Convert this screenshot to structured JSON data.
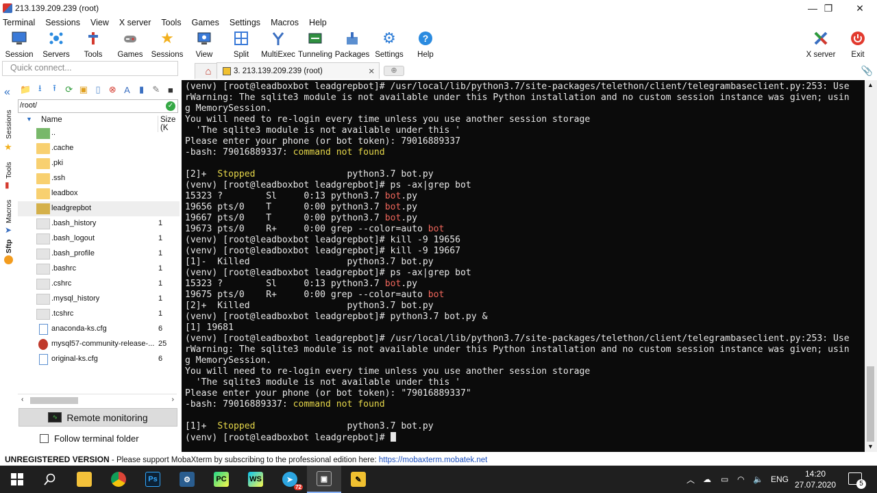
{
  "window": {
    "title": "213.139.209.239 (root)",
    "minimize": "—",
    "restore": "❐",
    "close": "✕"
  },
  "menu": [
    "Terminal",
    "Sessions",
    "View",
    "X server",
    "Tools",
    "Games",
    "Settings",
    "Macros",
    "Help"
  ],
  "toolbar": {
    "session": "Session",
    "servers": "Servers",
    "tools": "Tools",
    "games": "Games",
    "sessions": "Sessions",
    "view": "View",
    "split": "Split",
    "multiexec": "MultiExec",
    "tunneling": "Tunneling",
    "packages": "Packages",
    "settings": "Settings",
    "help": "Help",
    "xserver": "X server",
    "exit": "Exit"
  },
  "quick_connect": {
    "placeholder": "Quick connect..."
  },
  "tabs": {
    "active_tab": "3. 213.139.209.239 (root)",
    "close": "✕",
    "new_tab": "⊕"
  },
  "side_tabs": {
    "sessions": "Sessions",
    "tools": "Tools",
    "macros": "Macros",
    "sftp": "Sftp"
  },
  "sftp": {
    "path": "/root/",
    "col_name": "Name",
    "col_size": "Size (K",
    "files": [
      {
        "name": "..",
        "size": "",
        "kind": "up"
      },
      {
        "name": ".cache",
        "size": "",
        "kind": "folder"
      },
      {
        "name": ".pki",
        "size": "",
        "kind": "folder"
      },
      {
        "name": ".ssh",
        "size": "",
        "kind": "folder"
      },
      {
        "name": "leadbox",
        "size": "",
        "kind": "folder"
      },
      {
        "name": "leadgrepbot",
        "size": "",
        "kind": "folderd"
      },
      {
        "name": ".bash_history",
        "size": "1",
        "kind": "file"
      },
      {
        "name": ".bash_logout",
        "size": "1",
        "kind": "file"
      },
      {
        "name": ".bash_profile",
        "size": "1",
        "kind": "file"
      },
      {
        "name": ".bashrc",
        "size": "1",
        "kind": "file"
      },
      {
        "name": ".cshrc",
        "size": "1",
        "kind": "file"
      },
      {
        "name": ".mysql_history",
        "size": "1",
        "kind": "file"
      },
      {
        "name": ".tcshrc",
        "size": "1",
        "kind": "file"
      },
      {
        "name": "anaconda-ks.cfg",
        "size": "6",
        "kind": "doc"
      },
      {
        "name": "mysql57-community-release-...",
        "size": "25",
        "kind": "rpm"
      },
      {
        "name": "original-ks.cfg",
        "size": "6",
        "kind": "doc"
      }
    ],
    "remote_monitoring": "Remote monitoring",
    "follow_terminal": "Follow terminal folder"
  },
  "terminal": {
    "lines": [
      [
        {
          "t": "(venv) [root@leadboxbot leadgrepbot]# /usr/local/lib/python3.7/site-packages/telethon/client/telegrambaseclient.py:253: Use"
        }
      ],
      [
        {
          "t": "rWarning: The sqlite3 module is not available under this Python installation and no custom session instance was given; usin"
        }
      ],
      [
        {
          "t": "g MemorySession."
        }
      ],
      [
        {
          "t": "You will need to re-login every time unless you use another session storage"
        }
      ],
      [
        {
          "t": "  'The sqlite3 module is not available under this '"
        }
      ],
      [
        {
          "t": "Please enter your phone (or bot token): 79016889337"
        }
      ],
      [
        {
          "t": "-bash: 79016889337: "
        },
        {
          "t": "command not found",
          "c": "y"
        }
      ],
      [
        {
          "t": ""
        }
      ],
      [
        {
          "t": "[2]+  "
        },
        {
          "t": "Stopped",
          "c": "y"
        },
        {
          "t": "                 python3.7 bot.py"
        }
      ],
      [
        {
          "t": "(venv) [root@leadboxbot leadgrepbot]# ps -ax|grep bot"
        }
      ],
      [
        {
          "t": "15323 ?        Sl     0:13 python3.7 "
        },
        {
          "t": "bot",
          "c": "r"
        },
        {
          "t": ".py"
        }
      ],
      [
        {
          "t": "19656 pts/0    T      0:00 python3.7 "
        },
        {
          "t": "bot",
          "c": "r"
        },
        {
          "t": ".py"
        }
      ],
      [
        {
          "t": "19667 pts/0    T      0:00 python3.7 "
        },
        {
          "t": "bot",
          "c": "r"
        },
        {
          "t": ".py"
        }
      ],
      [
        {
          "t": "19673 pts/0    R+     0:00 grep --color=auto "
        },
        {
          "t": "bot",
          "c": "r"
        }
      ],
      [
        {
          "t": "(venv) [root@leadboxbot leadgrepbot]# kill -9 19656"
        }
      ],
      [
        {
          "t": "(venv) [root@leadboxbot leadgrepbot]# kill -9 19667"
        }
      ],
      [
        {
          "t": "[1]-  Killed                  python3.7 bot.py"
        }
      ],
      [
        {
          "t": "(venv) [root@leadboxbot leadgrepbot]# ps -ax|grep bot"
        }
      ],
      [
        {
          "t": "15323 ?        Sl     0:13 python3.7 "
        },
        {
          "t": "bot",
          "c": "r"
        },
        {
          "t": ".py"
        }
      ],
      [
        {
          "t": "19675 pts/0    R+     0:00 grep --color=auto "
        },
        {
          "t": "bot",
          "c": "r"
        }
      ],
      [
        {
          "t": "[2]+  Killed                  python3.7 bot.py"
        }
      ],
      [
        {
          "t": "(venv) [root@leadboxbot leadgrepbot]# python3.7 bot.py &"
        }
      ],
      [
        {
          "t": "[1] 19681"
        }
      ],
      [
        {
          "t": "(venv) [root@leadboxbot leadgrepbot]# /usr/local/lib/python3.7/site-packages/telethon/client/telegrambaseclient.py:253: Use"
        }
      ],
      [
        {
          "t": "rWarning: The sqlite3 module is not available under this Python installation and no custom session instance was given; usin"
        }
      ],
      [
        {
          "t": "g MemorySession."
        }
      ],
      [
        {
          "t": "You will need to re-login every time unless you use another session storage"
        }
      ],
      [
        {
          "t": "  'The sqlite3 module is not available under this '"
        }
      ],
      [
        {
          "t": "Please enter your phone (or bot token): \"79016889337\""
        }
      ],
      [
        {
          "t": "-bash: 79016889337: "
        },
        {
          "t": "command not found",
          "c": "y"
        }
      ],
      [
        {
          "t": ""
        }
      ],
      [
        {
          "t": "[1]+  "
        },
        {
          "t": "Stopped",
          "c": "y"
        },
        {
          "t": "                 python3.7 bot.py"
        }
      ],
      [
        {
          "t": "(venv) [root@leadboxbot leadgrepbot]# "
        },
        {
          "cursor": true
        }
      ]
    ]
  },
  "status": {
    "unregistered": "UNREGISTERED VERSION",
    "sep": "  -  ",
    "message": "Please support MobaXterm by subscribing to the professional edition here:  ",
    "link": "https://mobaxterm.mobatek.net"
  },
  "taskbar": {
    "lang": "ENG",
    "time": "14:20",
    "date": "27.07.2020",
    "notifications": "5",
    "telegram_badge": "72",
    "apps": [
      "start",
      "search",
      "file-explorer",
      "chrome",
      "photoshop",
      "network-app",
      "pycharm",
      "webstorm",
      "telegram",
      "mobaxterm",
      "mobaxterm-2"
    ]
  },
  "colors": {
    "terminal_bg": "#0b0b0b",
    "terminal_fg": "#e8e8e8",
    "highlight_yellow": "#e6d74a",
    "grep_red": "#f0665b",
    "taskbar_bg": "#1f1f1f"
  }
}
